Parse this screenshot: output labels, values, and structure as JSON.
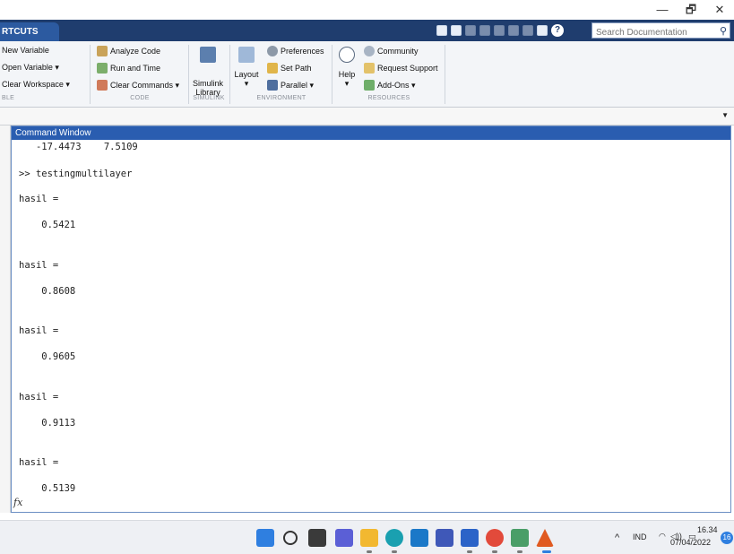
{
  "window": {
    "minimize_glyph": "—",
    "maximize_glyph": "🗗",
    "close_glyph": "✕"
  },
  "tabs": {
    "shortcuts_label": "RTCUTS"
  },
  "search": {
    "placeholder": "Search Documentation"
  },
  "ribbon": {
    "variable": {
      "new_variable": "New Variable",
      "open_variable": "Open Variable ▾",
      "clear_workspace": "Clear Workspace ▾",
      "group_label": "BLE"
    },
    "code": {
      "analyze_code": "Analyze Code",
      "run_and_time": "Run and Time",
      "clear_commands": "Clear Commands ▾",
      "group_label": "CODE"
    },
    "simulink": {
      "library_line1": "Simulink",
      "library_line2": "Library",
      "group_label": "SIMULINK"
    },
    "environment": {
      "layout": "Layout",
      "layout_arrow": "▾",
      "preferences": "Preferences",
      "set_path": "Set Path",
      "parallel": "Parallel ▾",
      "group_label": "ENVIRONMENT"
    },
    "resources": {
      "help": "Help",
      "help_arrow": "▾",
      "community": "Community",
      "request_support": "Request Support",
      "add_ons": "Add-Ons ▾",
      "group_label": "RESOURCES"
    }
  },
  "command_window": {
    "title": "Command Window",
    "lines": [
      "   -17.4473    7.5109",
      ">> testingmultilayer",
      "hasil =",
      "    0.5421",
      "hasil =",
      "    0.8608",
      "hasil =",
      "    0.9605",
      "hasil =",
      "    0.9113",
      "hasil =",
      "    0.5139"
    ],
    "prompt_icon": "fx"
  },
  "taskbar": {
    "tray_arrow": "^",
    "language": "IND",
    "wifi": "◠",
    "volume": "◁))",
    "battery": "▭",
    "time": "16.34",
    "date": "07/04/2022",
    "notification_count": "16"
  },
  "colors": {
    "tab_strip": "#1f3d6e",
    "command_title": "#2a5db0",
    "ribbon_bg": "#f3f5f8"
  }
}
